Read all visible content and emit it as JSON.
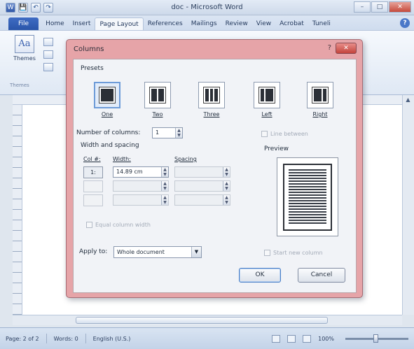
{
  "window": {
    "title": "doc - Microsoft Word",
    "minimize": "–",
    "maximize": "□",
    "close": "✕"
  },
  "quick_access": [
    "W",
    "💾",
    "↶",
    "↷"
  ],
  "tabs": [
    "File",
    "Home",
    "Insert",
    "Page Layout",
    "References",
    "Mailings",
    "Review",
    "View",
    "Acrobat",
    "Tuneli"
  ],
  "ribbon": {
    "themes_label": "Themes",
    "group_label": "Themes"
  },
  "statusbar": {
    "page": "Page: 2 of 2",
    "words": "Words: 0",
    "language": "English (U.S.)",
    "zoom": "100%",
    "zoom_level_pct": 100
  },
  "dialog": {
    "title": "Columns",
    "help": "?",
    "close": "✕",
    "presets_label": "Presets",
    "presets": [
      {
        "label": "One",
        "cols": 1
      },
      {
        "label": "Two",
        "cols": 2
      },
      {
        "label": "Three",
        "cols": 3
      },
      {
        "label": "Left",
        "cols": 2
      },
      {
        "label": "Right",
        "cols": 2
      }
    ],
    "selected_preset": "One",
    "number_of_columns_label": "Number of columns:",
    "number_of_columns_value": "1",
    "line_between_label": "Line between",
    "width_spacing_label": "Width and spacing",
    "col_header": "Col #:",
    "width_header": "Width:",
    "spacing_header": "Spacing",
    "rows": [
      {
        "col": "1:",
        "width": "14.89 cm",
        "spacing": ""
      },
      {
        "col": "",
        "width": "",
        "spacing": ""
      },
      {
        "col": "",
        "width": "",
        "spacing": ""
      }
    ],
    "equal_width_label": "Equal column width",
    "preview_label": "Preview",
    "apply_to_label": "Apply to:",
    "apply_to_value": "Whole document",
    "start_new_column_label": "Start new column",
    "ok_label": "OK",
    "cancel_label": "Cancel"
  }
}
